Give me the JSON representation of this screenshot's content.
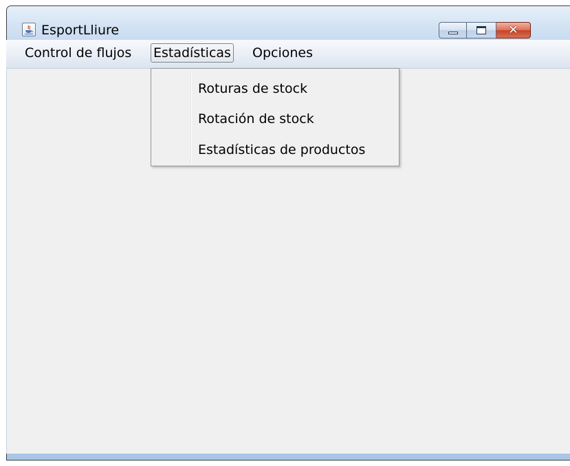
{
  "window": {
    "title": "EsportLliure",
    "icon": "java-coffee-icon",
    "caption_buttons": {
      "minimize_icon": "minimize-icon",
      "maximize_icon": "maximize-icon",
      "close_icon": "close-icon",
      "close_glyph": "✕"
    }
  },
  "menubar": {
    "items": [
      {
        "label": "Control de flujos"
      },
      {
        "label": "Estadísticas",
        "active": true
      },
      {
        "label": "Opciones"
      }
    ]
  },
  "dropdown": {
    "items": [
      {
        "label": "Roturas de stock"
      },
      {
        "label": "Rotación de stock"
      },
      {
        "label": "Estadísticas de productos"
      }
    ]
  },
  "colors": {
    "content_background": "#f0f0f0",
    "close_button": "#c7412a",
    "title_bar": "#d5e4f4"
  }
}
